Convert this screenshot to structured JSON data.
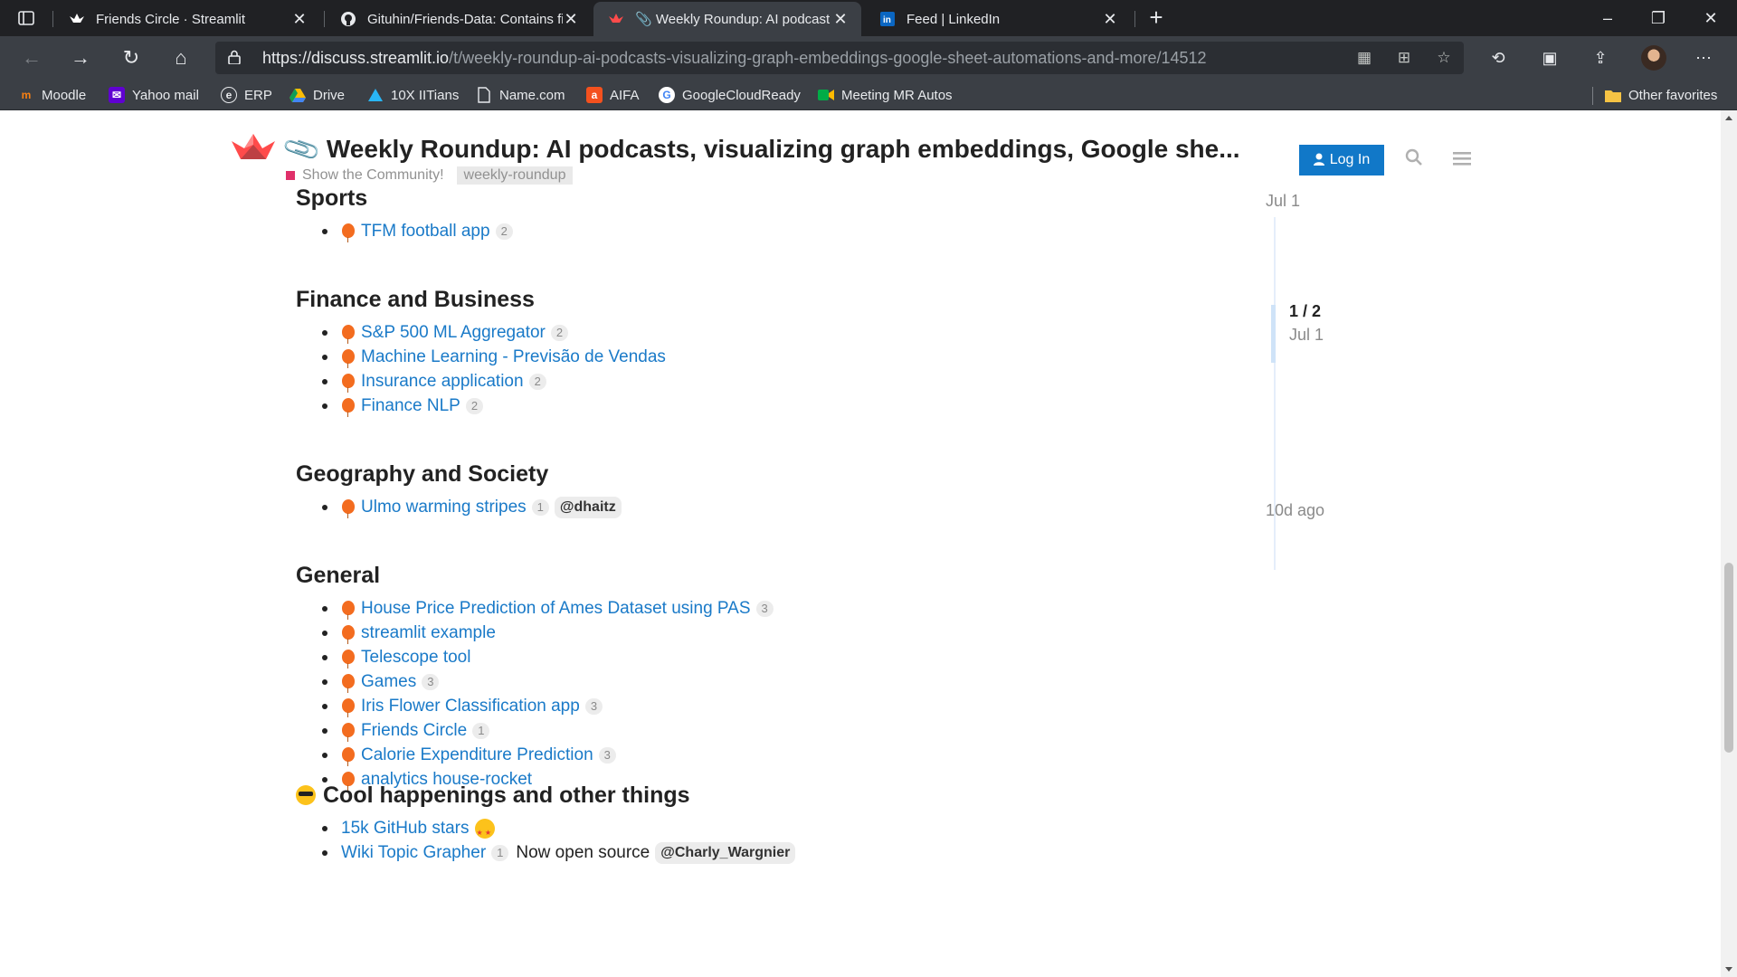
{
  "browser": {
    "tabs": [
      {
        "title": "Friends Circle · Streamlit",
        "icon": "streamlit-crown-icon"
      },
      {
        "title": "Gituhin/Friends-Data: Contains fi",
        "icon": "github-icon"
      },
      {
        "title": "📎 Weekly Roundup: AI podcast",
        "icon": "streamlit-crown-icon"
      },
      {
        "title": "Feed | LinkedIn",
        "icon": "linkedin-icon"
      }
    ],
    "url_host": "https://discuss.streamlit.io",
    "url_path": "/t/weekly-roundup-ai-podcasts-visualizing-graph-embeddings-google-sheet-automations-and-more/14512",
    "bookmarks": [
      {
        "label": "Moodle"
      },
      {
        "label": "Yahoo mail"
      },
      {
        "label": "ERP"
      },
      {
        "label": "Drive"
      },
      {
        "label": "10X IITians"
      },
      {
        "label": "Name.com"
      },
      {
        "label": "AIFA"
      },
      {
        "label": "GoogleCloudReady"
      },
      {
        "label": "Meeting MR Autos"
      }
    ],
    "other_favorites": "Other favorites"
  },
  "header": {
    "title": "Weekly Roundup: AI podcasts, visualizing graph embeddings, Google she...",
    "category": "Show the Community!",
    "tag": "weekly-roundup",
    "login": "Log In",
    "category_color": "#e0306a",
    "accent_color": "#1178c8"
  },
  "sections": {
    "sports": {
      "heading": "Sports",
      "items": [
        {
          "label": "TFM football app",
          "count": "2"
        }
      ]
    },
    "finance": {
      "heading": "Finance and Business",
      "items": [
        {
          "label": "S&P 500 ML Aggregator",
          "count": "2"
        },
        {
          "label": "Machine Learning - Previsão de Vendas",
          "count": ""
        },
        {
          "label": "Insurance application",
          "count": "2"
        },
        {
          "label": "Finance NLP",
          "count": "2"
        }
      ]
    },
    "geography": {
      "heading": "Geography and Society",
      "items": [
        {
          "label": "Ulmo warming stripes",
          "count": "1",
          "mention": "@dhaitz"
        }
      ]
    },
    "general": {
      "heading": "General",
      "items": [
        {
          "label": "House Price Prediction of Ames Dataset using PAS",
          "count": "3"
        },
        {
          "label": "streamlit example",
          "count": ""
        },
        {
          "label": "Telescope tool",
          "count": ""
        },
        {
          "label": "Games",
          "count": "3"
        },
        {
          "label": "Iris Flower Classification app",
          "count": "3"
        },
        {
          "label": "Friends Circle",
          "count": "1"
        },
        {
          "label": "Calorie Expenditure Prediction",
          "count": "3"
        },
        {
          "label": "analytics house-rocket",
          "count": ""
        }
      ]
    },
    "cool": {
      "heading": "Cool happenings and other things",
      "items": [
        {
          "label": "15k GitHub stars",
          "count": ""
        },
        {
          "label": "Wiki Topic Grapher",
          "count": "1",
          "text": "Now open source",
          "mention": "@Charly_Wargnier"
        }
      ]
    }
  },
  "timeline": {
    "start_date": "Jul 1",
    "position": "1 / 2",
    "position_date": "Jul 1",
    "end_date": "10d ago"
  },
  "balloon_color": "#f36c1f",
  "link_color": "#1a7ac8"
}
